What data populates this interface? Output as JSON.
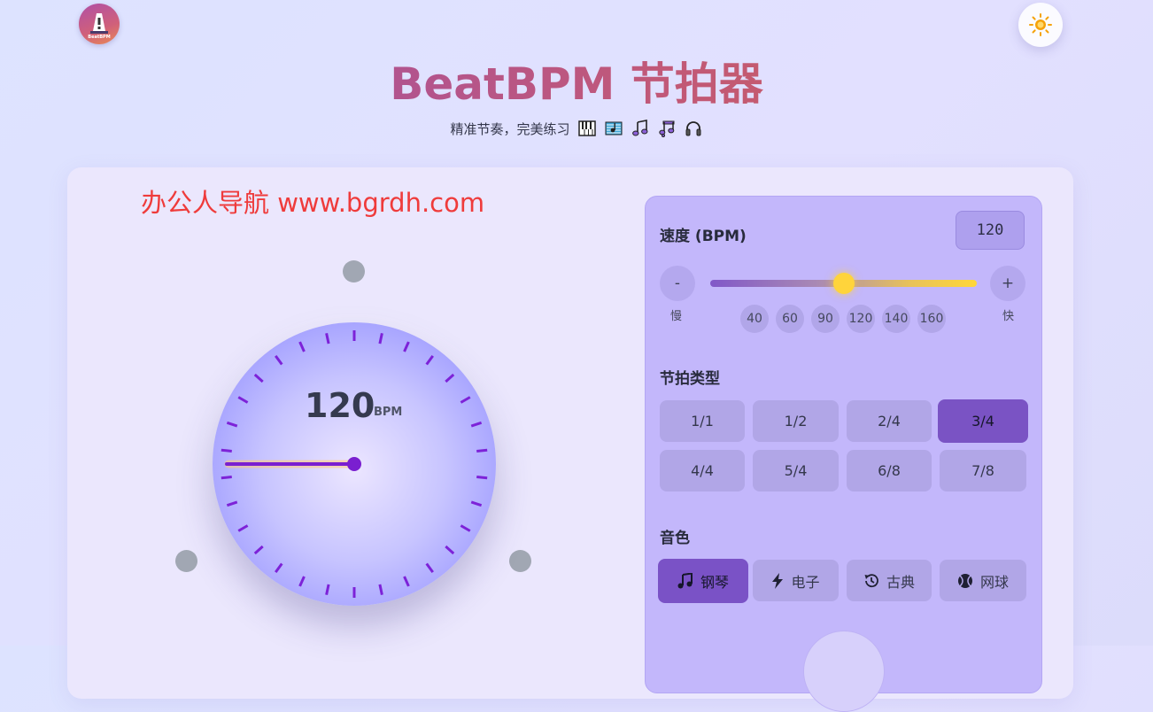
{
  "app": {
    "logo_caption": "BeatBPM",
    "title": "BeatBPM 节拍器",
    "subtitle": "精准节奏，完美练习",
    "subtitle_emojis": [
      "piano-icon",
      "musical-score-icon",
      "musical-note-icon",
      "musical-notes-icon",
      "headphones-icon"
    ]
  },
  "watermark": "办公人导航  www.bgrdh.com",
  "dial": {
    "bpm_value": "120",
    "bpm_unit": "BPM",
    "beats_per_bar": 3
  },
  "tempo": {
    "label": "速度 (BPM)",
    "value": "120",
    "min": 40,
    "max": 200,
    "decrease_label": "-",
    "increase_label": "+",
    "slow_label": "慢",
    "fast_label": "快",
    "presets": [
      "40",
      "60",
      "90",
      "120",
      "140",
      "160"
    ]
  },
  "time_signature": {
    "label": "节拍类型",
    "options": [
      "1/1",
      "1/2",
      "2/4",
      "3/4",
      "4/4",
      "5/4",
      "6/8",
      "7/8"
    ],
    "selected": "3/4"
  },
  "sound": {
    "label": "音色",
    "options": [
      {
        "label": "钢琴",
        "icon": "music-note-icon"
      },
      {
        "label": "电子",
        "icon": "lightning-icon"
      },
      {
        "label": "古典",
        "icon": "history-icon"
      },
      {
        "label": "网球",
        "icon": "tennis-ball-icon"
      }
    ],
    "selected": "钢琴"
  },
  "colors": {
    "accent": "#7a52c6",
    "panel": "#c3b7fb",
    "slider_thumb": "#ffd43b",
    "watermark": "#ef3b3b"
  }
}
